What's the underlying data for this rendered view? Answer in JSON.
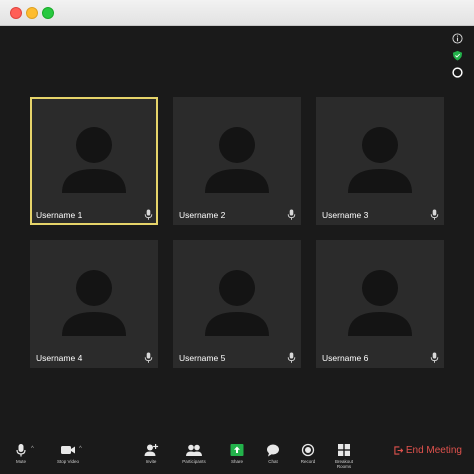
{
  "participants": [
    {
      "name": "Username 1",
      "active": true
    },
    {
      "name": "Username 2",
      "active": false
    },
    {
      "name": "Username 3",
      "active": false
    },
    {
      "name": "Username 4",
      "active": false
    },
    {
      "name": "Username  5",
      "active": false
    },
    {
      "name": "Username  6",
      "active": false
    }
  ],
  "toolbar": {
    "mute": "Mute",
    "stop_video": "Stop Video",
    "invite": "Invite",
    "participants": "Participants",
    "share": "Share",
    "chat": "Chat",
    "record": "Record",
    "breakout": "Breakout Rooms",
    "end_meeting": "End Meeting"
  },
  "colors": {
    "active_border": "#e6d46a",
    "share_green": "#23b24b",
    "end_red": "#e0524d",
    "tile_bg": "#2b2b2b"
  }
}
